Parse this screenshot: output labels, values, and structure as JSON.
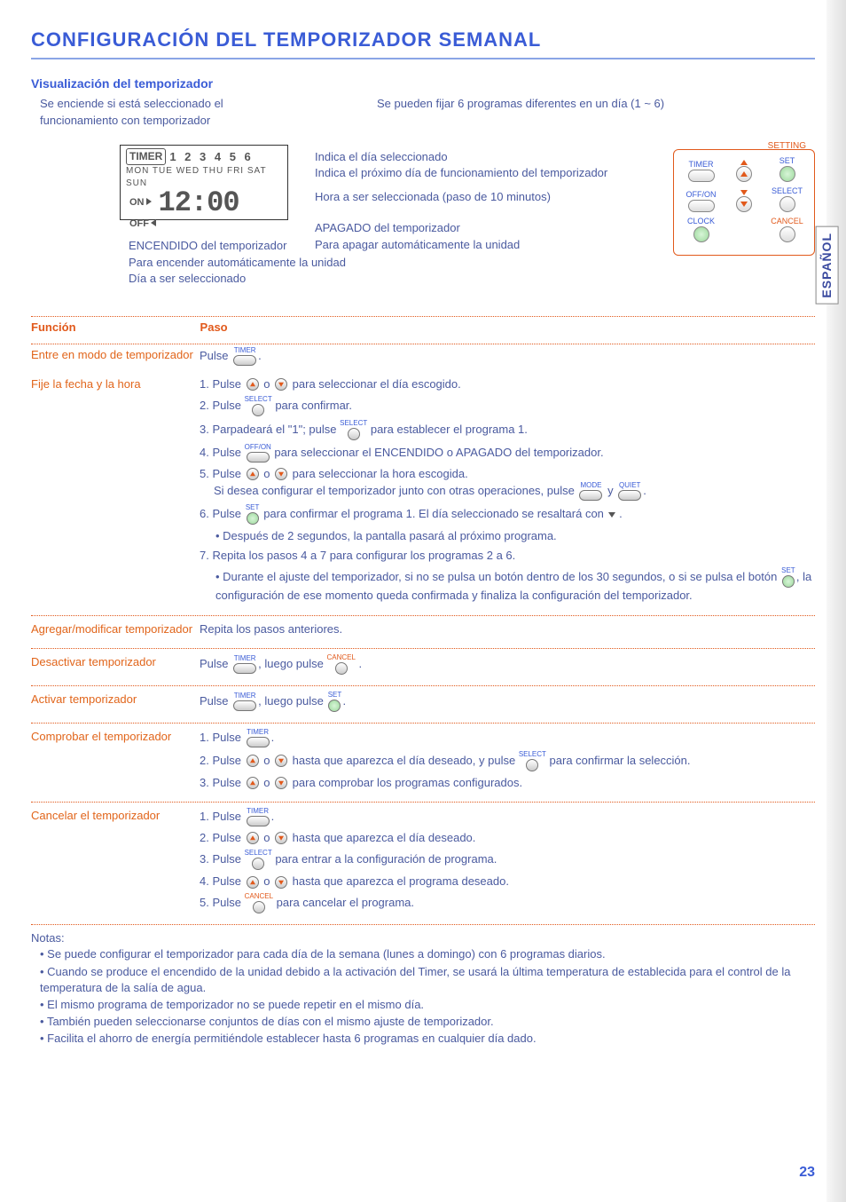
{
  "page": {
    "title": "CONFIGURACIÓN DEL TEMPORIZADOR SEMANAL",
    "language_tab": "ESPAÑOL",
    "page_number": "23"
  },
  "display_section": {
    "heading": "Visualización del temporizador",
    "note_top_left": "Se enciende si está seleccionado el funcionamiento con temporizador",
    "note_top_right": "Se pueden fijar 6 programas diferentes en un día (1 ~ 6)",
    "lcd": {
      "timer_badge": "TIMER",
      "programs": "1 2 3 4 5 6",
      "days": "MON TUE WED THU FRI SAT SUN",
      "on": "ON",
      "off": "OFF",
      "time": "12:00"
    },
    "annotation_day_selected": "Indica el día seleccionado",
    "annotation_next_day": "Indica el próximo día de funcionamiento del temporizador",
    "annotation_time": "Hora a ser seleccionada (paso de 10 minutos)",
    "annotation_off": "APAGADO del temporizador\nPara apagar automáticamente la unidad",
    "annotation_on_block": "ENCENDIDO del temporizador\nPara encender automáticamente la unidad\nDía a ser seleccionado",
    "remote": {
      "setting": "SETTING",
      "timer": "TIMER",
      "set": "SET",
      "off_on": "OFF/ON",
      "select": "SELECT",
      "clock": "CLOCK",
      "cancel": "CANCEL"
    }
  },
  "table_headers": {
    "function": "Función",
    "step": "Paso"
  },
  "functions": {
    "enter_timer": {
      "label": "Entre en modo de temporizador",
      "step1_a": "Pulse "
    },
    "set_date_time": {
      "label": "Fije la fecha y la hora",
      "s1a": "1. Pulse ",
      "s1b": " o ",
      "s1c": " para seleccionar el día escogido.",
      "s2a": "2. Pulse ",
      "s2b": " para confirmar.",
      "s3a": "3. Parpadeará el \"1\"; pulse ",
      "s3b": " para establecer el programa 1.",
      "s4a": "4. Pulse ",
      "s4b": " para seleccionar el ENCENDIDO o APAGADO del temporizador.",
      "s5a": "5. Pulse ",
      "s5b": " o ",
      "s5c": " para seleccionar la hora escogida.",
      "s5d": "Si desea configurar el temporizador junto con otras operaciones, pulse ",
      "s5e": " y ",
      "s6a": "6. Pulse ",
      "s6b": " para confirmar el programa 1. El día seleccionado se resaltará con ",
      "s6_bullet": "• Después de 2 segundos, la pantalla pasará al próximo programa.",
      "s7": "7. Repita los pasos 4 a 7 para configurar los programas 2 a 6.",
      "s7_bullet_a": "• Durante el ajuste del temporizador, si no se pulsa un botón dentro de los 30 segundos, o si se pulsa el botón ",
      "s7_bullet_b": ", la configuración de ese momento queda confirmada y finaliza la configuración del temporizador.",
      "labels": {
        "select": "SELECT",
        "offon": "OFF/ON",
        "set": "SET",
        "mode": "MODE",
        "quiet": "QUIET",
        "timer": "TIMER",
        "cancel": "CANCEL"
      }
    },
    "add_modify": {
      "label": "Agregar/modificar temporizador",
      "step": "Repita los pasos anteriores."
    },
    "disable": {
      "label": "Desactivar temporizador",
      "a": " Pulse ",
      "b": ", luego pulse "
    },
    "enable": {
      "label": "Activar temporizador",
      "a": "Pulse ",
      "b": ", luego pulse "
    },
    "check": {
      "label": "Comprobar el temporizador",
      "s1": "1. Pulse ",
      "s2a": "2. Pulse ",
      "s2b": " o ",
      "s2c": " hasta que aparezca el día deseado, y pulse ",
      "s2d": " para confirmar la selección.",
      "s3a": "3. Pulse ",
      "s3b": " o ",
      "s3c": " para comprobar los programas configurados."
    },
    "cancel": {
      "label": "Cancelar el temporizador",
      "s1": "1. Pulse ",
      "s2a": "2. Pulse ",
      "s2b": " o ",
      "s2c": " hasta que aparezca el día deseado.",
      "s3a": "3. Pulse ",
      "s3b": " para entrar a la configuración de programa.",
      "s4a": "4. Pulse ",
      "s4b": " o ",
      "s4c": " hasta que aparezca el programa deseado.",
      "s5a": "5. Pulse ",
      "s5b": " para cancelar el programa."
    }
  },
  "notes": {
    "heading": "Notas:",
    "items": [
      "Se puede configurar el temporizador para cada día de la semana (lunes a domingo) con 6 programas diarios.",
      "Cuando se produce el encendido de la unidad debido a la activación del Timer, se usará la última temperatura de establecida para el control de la temperatura de la salía de agua.",
      "El mismo programa de temporizador no se puede repetir en el mismo día.",
      "También pueden seleccionarse conjuntos de días con el mismo ajuste de temporizador.",
      "Facilita el ahorro de energía permitiéndole establecer hasta 6 programas en cualquier día dado."
    ]
  }
}
